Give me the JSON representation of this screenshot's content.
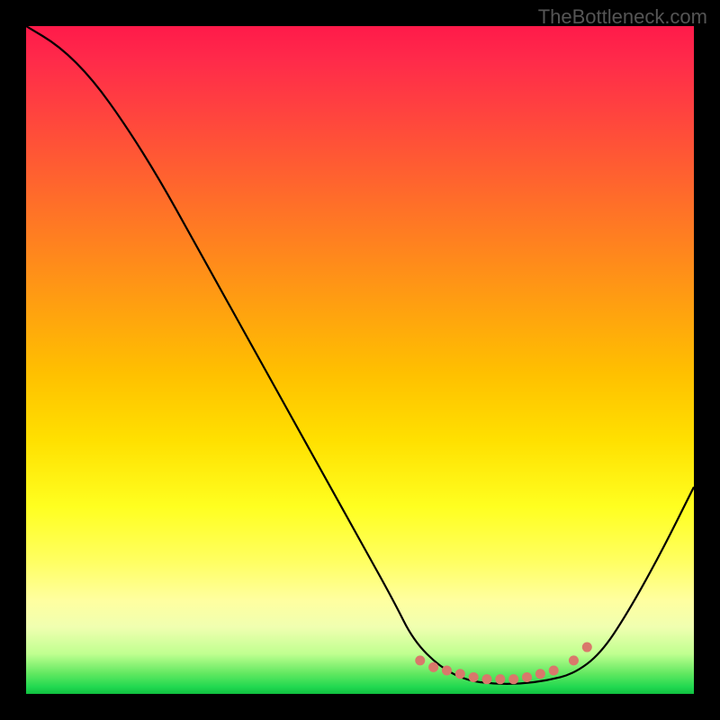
{
  "attribution": "TheBottleneck.com",
  "chart_data": {
    "type": "line",
    "title": "",
    "xlabel": "",
    "ylabel": "",
    "xlim": [
      0,
      100
    ],
    "ylim": [
      0,
      100
    ],
    "series": [
      {
        "name": "bottleneck-curve",
        "x": [
          0,
          5,
          10,
          15,
          20,
          25,
          30,
          35,
          40,
          45,
          50,
          55,
          58,
          62,
          66,
          70,
          74,
          78,
          82,
          86,
          90,
          95,
          100
        ],
        "y": [
          100,
          97,
          92,
          85,
          77,
          68,
          59,
          50,
          41,
          32,
          23,
          14,
          8,
          4,
          2,
          1.5,
          1.5,
          2,
          3,
          6,
          12,
          21,
          31
        ],
        "color": "#000000"
      },
      {
        "name": "optimal-zone-dots",
        "type": "scatter",
        "x": [
          59,
          61,
          63,
          65,
          67,
          69,
          71,
          73,
          75,
          77,
          79,
          82,
          84
        ],
        "y": [
          5,
          4,
          3.5,
          3,
          2.5,
          2.2,
          2.2,
          2.2,
          2.5,
          3,
          3.5,
          5,
          7
        ],
        "color": "#d9786b"
      }
    ]
  }
}
